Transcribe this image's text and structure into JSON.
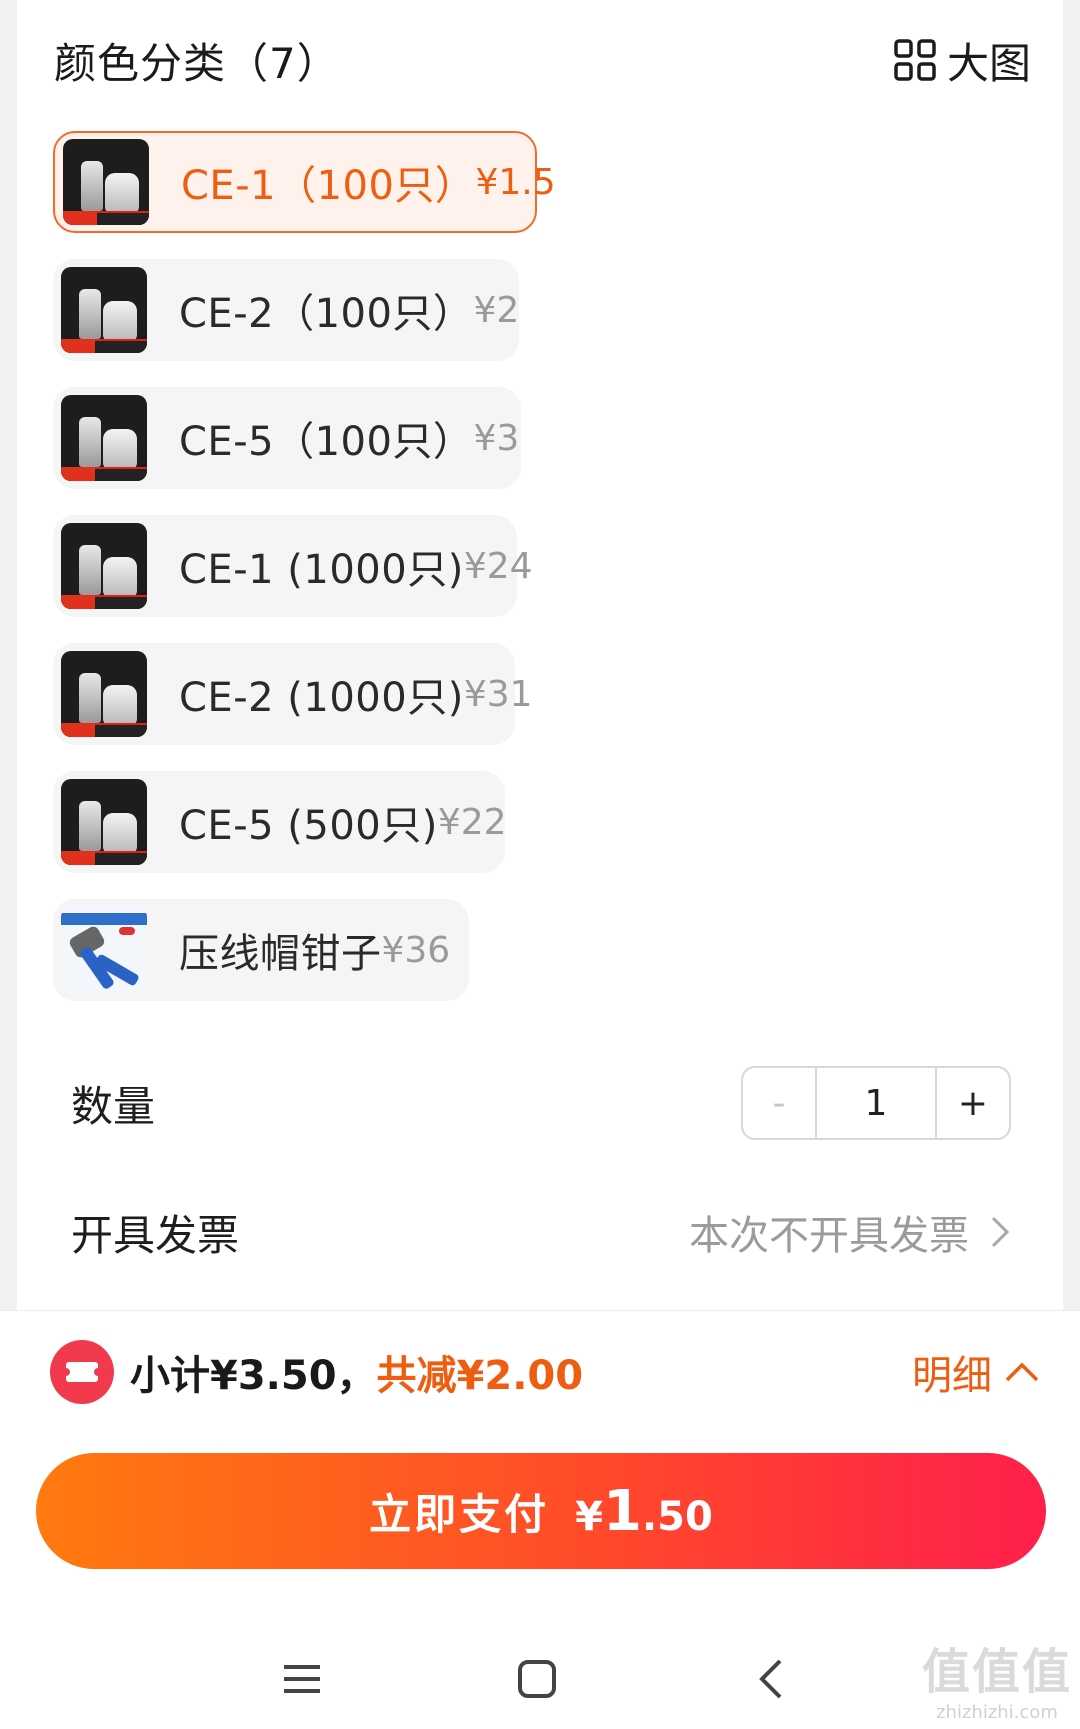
{
  "header": {
    "title": "颜色分类（7）",
    "big_view_label": "大图",
    "big_view_icon": "grid-icon"
  },
  "options": [
    {
      "label": "CE-1（100只）",
      "price": "¥1.5",
      "selected": true
    },
    {
      "label": "CE-2（100只）",
      "price": "¥2",
      "selected": false
    },
    {
      "label": "CE-5（100只）",
      "price": "¥3",
      "selected": false
    },
    {
      "label": "CE-1 (1000只)",
      "price": "¥24",
      "selected": false
    },
    {
      "label": "CE-2 (1000只)",
      "price": "¥31",
      "selected": false
    },
    {
      "label": "CE-5 (500只)",
      "price": "¥22",
      "selected": false
    },
    {
      "label": "压线帽钳子",
      "price": "¥36",
      "selected": false
    }
  ],
  "quantity": {
    "label": "数量",
    "minus": "-",
    "value": "1",
    "plus": "+"
  },
  "invoice": {
    "label": "开具发票",
    "value": "本次不开具发票"
  },
  "summary": {
    "subtotal": "小计¥3.50，",
    "discount": "共减¥2.00",
    "detail": "明细"
  },
  "pay": {
    "label": "立即支付",
    "currency": "¥",
    "amount_int": "1",
    "amount_dec": ".50"
  },
  "watermark": {
    "marks": "值值值",
    "url": "zhizhizhi.com"
  },
  "colors": {
    "accent": "#ef5d10",
    "selected_bg": "#fff2ec",
    "coupon": "#f23a4e"
  }
}
